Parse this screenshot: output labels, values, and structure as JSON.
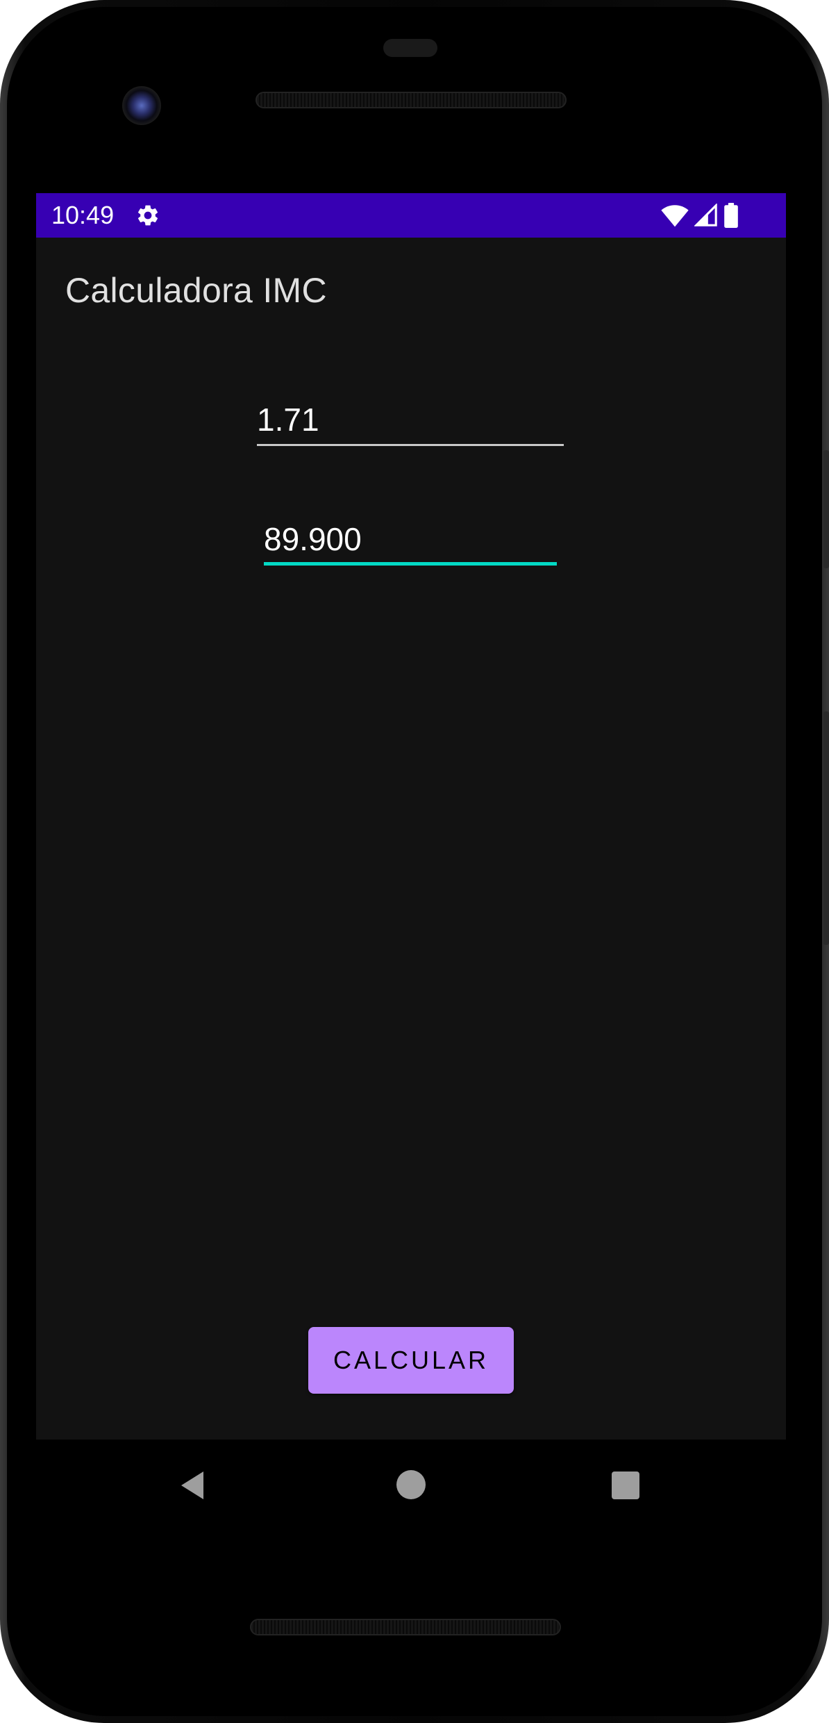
{
  "status_bar": {
    "time": "10:49",
    "background_color": "#3700b3",
    "icons": [
      "settings-gear-icon",
      "wifi-icon",
      "cell-signal-icon",
      "battery-icon"
    ]
  },
  "app": {
    "title": "Calculadora IMC"
  },
  "form": {
    "height_value": "1.71",
    "weight_value": "89.900",
    "focused_field": "weight",
    "accent_color": "#03dac5"
  },
  "button": {
    "calculate_label": "CALCULAR",
    "color": "#bb86fc"
  },
  "nav_bar": {
    "icons": [
      "back-icon",
      "home-icon",
      "recents-icon"
    ]
  }
}
